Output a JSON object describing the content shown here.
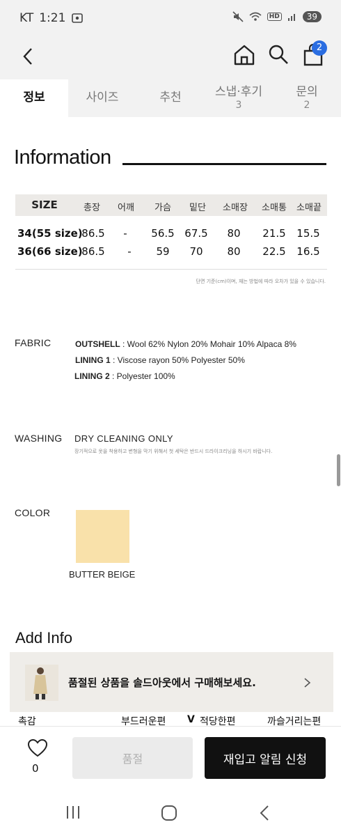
{
  "status": {
    "carrier": "KT",
    "time": "1:21",
    "battery": "39",
    "hd": "HD"
  },
  "header": {
    "cart_count": "2"
  },
  "tabs": [
    {
      "label": "정보",
      "count": ""
    },
    {
      "label": "사이즈",
      "count": ""
    },
    {
      "label": "추천",
      "count": ""
    },
    {
      "label": "스냅·후기",
      "count": "3"
    },
    {
      "label": "문의",
      "count": "2"
    }
  ],
  "info": {
    "title": "Information"
  },
  "size_table": {
    "headers": [
      "SIZE",
      "총장",
      "어깨",
      "가슴",
      "밑단",
      "소매장",
      "소매통",
      "소매끝"
    ],
    "rows": [
      [
        "34(55 size)",
        "86.5",
        "-",
        "56.5",
        "67.5",
        "80",
        "21.5",
        "15.5"
      ],
      [
        "36(66 size)",
        "86.5",
        "-",
        "59",
        "70",
        "80",
        "22.5",
        "16.5"
      ]
    ],
    "note": "단면 기준(cm)이며, 재는 방법에 따라 오차가 있을 수 있습니다."
  },
  "fabric": {
    "label": "FABRIC",
    "lines": [
      {
        "key": "OUTSHELL",
        "value": " : Wool 62% Nylon 20% Mohair 10% Alpaca 8%"
      },
      {
        "key": "LINING 1",
        "value": " : Viscose rayon 50% Polyester 50%"
      },
      {
        "key": "LINING 2",
        "value": " : Polyester 100%"
      }
    ]
  },
  "washing": {
    "label": "WASHING",
    "value": "DRY CLEANING ONLY",
    "note": "장기적으로 옷을 착용하고 변형을 막기 위해서 첫 세탁은 반드시 드라이크리닝을 하시기 바랍니다."
  },
  "color": {
    "label": "COLOR",
    "name": "BUTTER BEIGE",
    "swatch": "#f9e1aa"
  },
  "add_info": {
    "title": "Add Info",
    "soldout_banner": "품절된 상품을 솔드아웃에서 구매해보세요.",
    "feel_label": "촉감",
    "feel_options": [
      "부드러운편",
      "적당한편",
      "까슬거리는편"
    ],
    "feel_mark": "V"
  },
  "bottom": {
    "like_count": "0",
    "soldout_label": "품절",
    "notify_label": "재입고 알림 신청"
  }
}
